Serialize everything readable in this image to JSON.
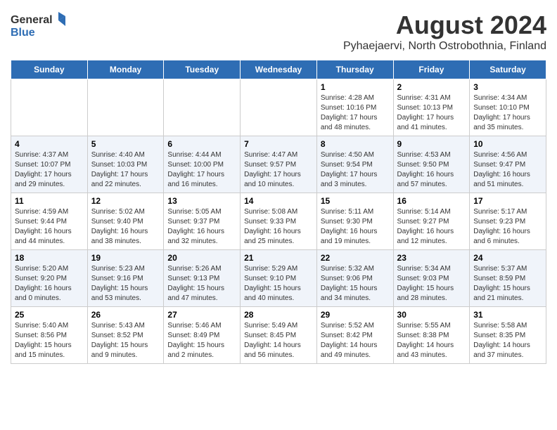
{
  "header": {
    "logo_general": "General",
    "logo_blue": "Blue",
    "title": "August 2024",
    "subtitle": "Pyhaejaervi, North Ostrobothnia, Finland"
  },
  "days_of_week": [
    "Sunday",
    "Monday",
    "Tuesday",
    "Wednesday",
    "Thursday",
    "Friday",
    "Saturday"
  ],
  "weeks": [
    [
      {
        "day": "",
        "info": ""
      },
      {
        "day": "",
        "info": ""
      },
      {
        "day": "",
        "info": ""
      },
      {
        "day": "",
        "info": ""
      },
      {
        "day": "1",
        "info": "Sunrise: 4:28 AM\nSunset: 10:16 PM\nDaylight: 17 hours\nand 48 minutes."
      },
      {
        "day": "2",
        "info": "Sunrise: 4:31 AM\nSunset: 10:13 PM\nDaylight: 17 hours\nand 41 minutes."
      },
      {
        "day": "3",
        "info": "Sunrise: 4:34 AM\nSunset: 10:10 PM\nDaylight: 17 hours\nand 35 minutes."
      }
    ],
    [
      {
        "day": "4",
        "info": "Sunrise: 4:37 AM\nSunset: 10:07 PM\nDaylight: 17 hours\nand 29 minutes."
      },
      {
        "day": "5",
        "info": "Sunrise: 4:40 AM\nSunset: 10:03 PM\nDaylight: 17 hours\nand 22 minutes."
      },
      {
        "day": "6",
        "info": "Sunrise: 4:44 AM\nSunset: 10:00 PM\nDaylight: 17 hours\nand 16 minutes."
      },
      {
        "day": "7",
        "info": "Sunrise: 4:47 AM\nSunset: 9:57 PM\nDaylight: 17 hours\nand 10 minutes."
      },
      {
        "day": "8",
        "info": "Sunrise: 4:50 AM\nSunset: 9:54 PM\nDaylight: 17 hours\nand 3 minutes."
      },
      {
        "day": "9",
        "info": "Sunrise: 4:53 AM\nSunset: 9:50 PM\nDaylight: 16 hours\nand 57 minutes."
      },
      {
        "day": "10",
        "info": "Sunrise: 4:56 AM\nSunset: 9:47 PM\nDaylight: 16 hours\nand 51 minutes."
      }
    ],
    [
      {
        "day": "11",
        "info": "Sunrise: 4:59 AM\nSunset: 9:44 PM\nDaylight: 16 hours\nand 44 minutes."
      },
      {
        "day": "12",
        "info": "Sunrise: 5:02 AM\nSunset: 9:40 PM\nDaylight: 16 hours\nand 38 minutes."
      },
      {
        "day": "13",
        "info": "Sunrise: 5:05 AM\nSunset: 9:37 PM\nDaylight: 16 hours\nand 32 minutes."
      },
      {
        "day": "14",
        "info": "Sunrise: 5:08 AM\nSunset: 9:33 PM\nDaylight: 16 hours\nand 25 minutes."
      },
      {
        "day": "15",
        "info": "Sunrise: 5:11 AM\nSunset: 9:30 PM\nDaylight: 16 hours\nand 19 minutes."
      },
      {
        "day": "16",
        "info": "Sunrise: 5:14 AM\nSunset: 9:27 PM\nDaylight: 16 hours\nand 12 minutes."
      },
      {
        "day": "17",
        "info": "Sunrise: 5:17 AM\nSunset: 9:23 PM\nDaylight: 16 hours\nand 6 minutes."
      }
    ],
    [
      {
        "day": "18",
        "info": "Sunrise: 5:20 AM\nSunset: 9:20 PM\nDaylight: 16 hours\nand 0 minutes."
      },
      {
        "day": "19",
        "info": "Sunrise: 5:23 AM\nSunset: 9:16 PM\nDaylight: 15 hours\nand 53 minutes."
      },
      {
        "day": "20",
        "info": "Sunrise: 5:26 AM\nSunset: 9:13 PM\nDaylight: 15 hours\nand 47 minutes."
      },
      {
        "day": "21",
        "info": "Sunrise: 5:29 AM\nSunset: 9:10 PM\nDaylight: 15 hours\nand 40 minutes."
      },
      {
        "day": "22",
        "info": "Sunrise: 5:32 AM\nSunset: 9:06 PM\nDaylight: 15 hours\nand 34 minutes."
      },
      {
        "day": "23",
        "info": "Sunrise: 5:34 AM\nSunset: 9:03 PM\nDaylight: 15 hours\nand 28 minutes."
      },
      {
        "day": "24",
        "info": "Sunrise: 5:37 AM\nSunset: 8:59 PM\nDaylight: 15 hours\nand 21 minutes."
      }
    ],
    [
      {
        "day": "25",
        "info": "Sunrise: 5:40 AM\nSunset: 8:56 PM\nDaylight: 15 hours\nand 15 minutes."
      },
      {
        "day": "26",
        "info": "Sunrise: 5:43 AM\nSunset: 8:52 PM\nDaylight: 15 hours\nand 9 minutes."
      },
      {
        "day": "27",
        "info": "Sunrise: 5:46 AM\nSunset: 8:49 PM\nDaylight: 15 hours\nand 2 minutes."
      },
      {
        "day": "28",
        "info": "Sunrise: 5:49 AM\nSunset: 8:45 PM\nDaylight: 14 hours\nand 56 minutes."
      },
      {
        "day": "29",
        "info": "Sunrise: 5:52 AM\nSunset: 8:42 PM\nDaylight: 14 hours\nand 49 minutes."
      },
      {
        "day": "30",
        "info": "Sunrise: 5:55 AM\nSunset: 8:38 PM\nDaylight: 14 hours\nand 43 minutes."
      },
      {
        "day": "31",
        "info": "Sunrise: 5:58 AM\nSunset: 8:35 PM\nDaylight: 14 hours\nand 37 minutes."
      }
    ]
  ]
}
